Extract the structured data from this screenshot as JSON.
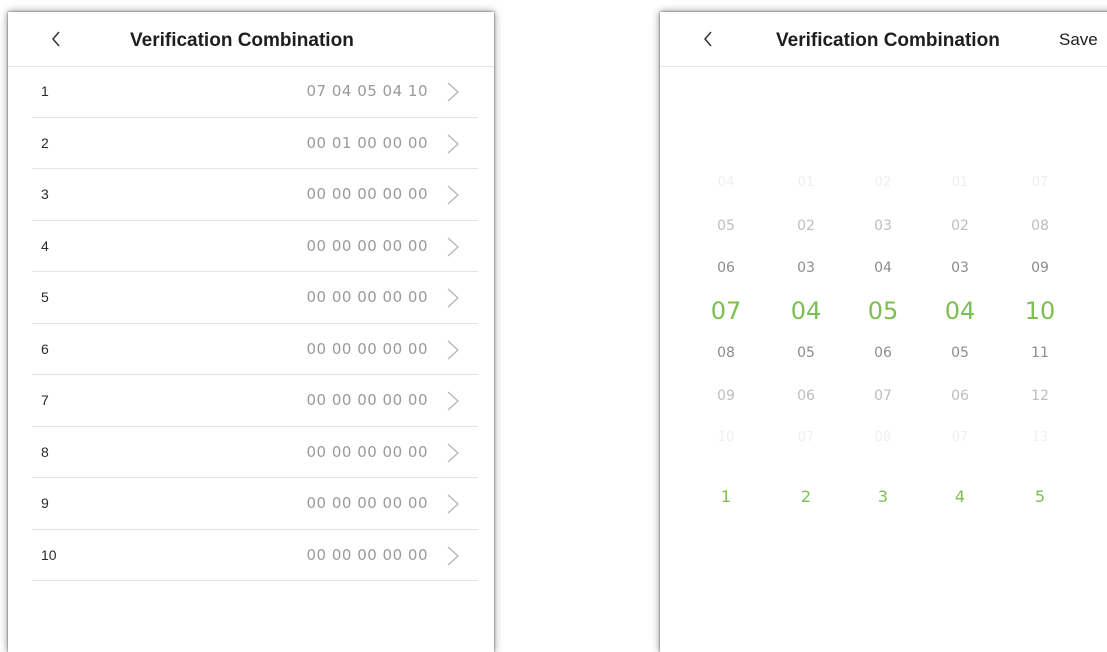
{
  "left": {
    "title": "Verification Combination",
    "rows": [
      {
        "index": "1",
        "value": "07 04 05 04 10"
      },
      {
        "index": "2",
        "value": "00 01 00 00 00"
      },
      {
        "index": "3",
        "value": "00 00 00 00 00"
      },
      {
        "index": "4",
        "value": "00 00 00 00 00"
      },
      {
        "index": "5",
        "value": "00 00 00 00 00"
      },
      {
        "index": "6",
        "value": "00 00 00 00 00"
      },
      {
        "index": "7",
        "value": "00 00 00 00 00"
      },
      {
        "index": "8",
        "value": "00 00 00 00 00"
      },
      {
        "index": "9",
        "value": "00 00 00 00 00"
      },
      {
        "index": "10",
        "value": "00 00 00 00 00"
      }
    ]
  },
  "right": {
    "title": "Verification Combination",
    "save_label": "Save",
    "picker_columns": [
      {
        "values": [
          "04",
          "05",
          "06",
          "07",
          "08",
          "09",
          "10"
        ],
        "selected": "07",
        "label": "1"
      },
      {
        "values": [
          "01",
          "02",
          "03",
          "04",
          "05",
          "06",
          "07"
        ],
        "selected": "04",
        "label": "2"
      },
      {
        "values": [
          "02",
          "03",
          "04",
          "05",
          "06",
          "07",
          "08"
        ],
        "selected": "05",
        "label": "3"
      },
      {
        "values": [
          "01",
          "02",
          "03",
          "04",
          "05",
          "06",
          "07"
        ],
        "selected": "04",
        "label": "4"
      },
      {
        "values": [
          "07",
          "08",
          "09",
          "10",
          "11",
          "12",
          "13"
        ],
        "selected": "10",
        "label": "5"
      }
    ]
  },
  "colors": {
    "accent": "#7cbf50",
    "text": "#1e1e1e",
    "value_text": "#9a9a9a",
    "divider": "#e3e3e3"
  },
  "icons": {
    "back": "chevron-left-icon",
    "row_arrow": "chevron-right-icon"
  }
}
